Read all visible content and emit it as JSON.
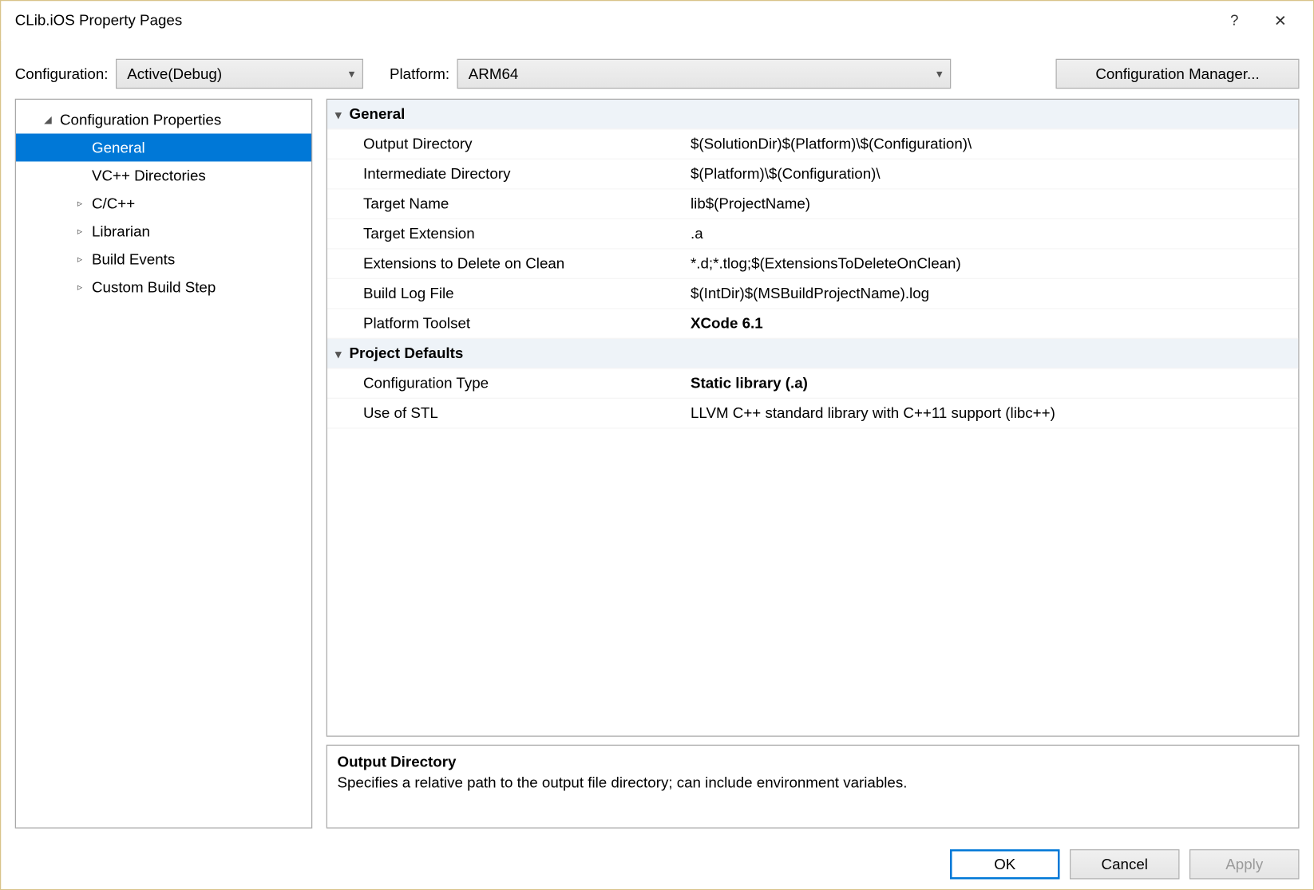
{
  "window": {
    "title": "CLib.iOS Property Pages",
    "help_label": "?",
    "close_label": "✕"
  },
  "toolbar": {
    "configuration_label": "Configuration:",
    "configuration_value": "Active(Debug)",
    "platform_label": "Platform:",
    "platform_value": "ARM64",
    "config_manager_label": "Configuration Manager..."
  },
  "tree": {
    "root": "Configuration Properties",
    "items": [
      {
        "label": "General",
        "expander": "",
        "selected": true
      },
      {
        "label": "VC++ Directories",
        "expander": ""
      },
      {
        "label": "C/C++",
        "expander": "▹"
      },
      {
        "label": "Librarian",
        "expander": "▹"
      },
      {
        "label": "Build Events",
        "expander": "▹"
      },
      {
        "label": "Custom Build Step",
        "expander": "▹"
      }
    ]
  },
  "grid": {
    "cat1": "General",
    "props1": [
      {
        "k": "Output Directory",
        "v": "$(SolutionDir)$(Platform)\\$(Configuration)\\"
      },
      {
        "k": "Intermediate Directory",
        "v": "$(Platform)\\$(Configuration)\\"
      },
      {
        "k": "Target Name",
        "v": "lib$(ProjectName)"
      },
      {
        "k": "Target Extension",
        "v": ".a"
      },
      {
        "k": "Extensions to Delete on Clean",
        "v": "*.d;*.tlog;$(ExtensionsToDeleteOnClean)"
      },
      {
        "k": "Build Log File",
        "v": "$(IntDir)$(MSBuildProjectName).log"
      },
      {
        "k": "Platform Toolset",
        "v": "XCode 6.1",
        "bold": true
      }
    ],
    "cat2": "Project Defaults",
    "props2": [
      {
        "k": "Configuration Type",
        "v": "Static library (.a)",
        "bold": true
      },
      {
        "k": "Use of STL",
        "v": "LLVM C++ standard library with C++11 support (libc++)"
      }
    ]
  },
  "desc": {
    "heading": "Output Directory",
    "body": "Specifies a relative path to the output file directory; can include environment variables."
  },
  "footer": {
    "ok": "OK",
    "cancel": "Cancel",
    "apply": "Apply"
  }
}
